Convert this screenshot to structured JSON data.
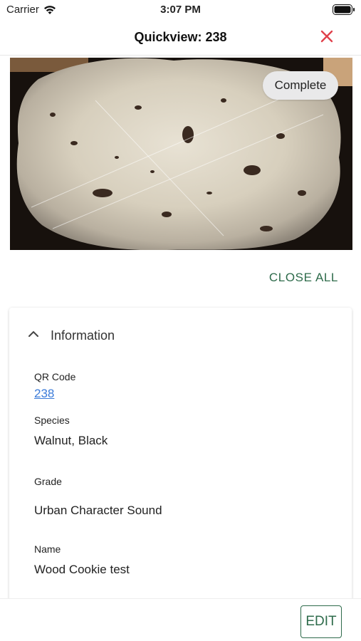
{
  "status_bar": {
    "carrier": "Carrier",
    "time": "3:07 PM"
  },
  "nav": {
    "title": "Quickview: 238",
    "close_icon": "close-x-icon",
    "close_color": "#e0414b"
  },
  "photo": {
    "status_badge": "Complete"
  },
  "actions": {
    "close_all_label": "CLOSE ALL",
    "edit_label": "EDIT",
    "accent_color": "#2e6b4b"
  },
  "information": {
    "title": "Information",
    "expanded": true,
    "fields": {
      "qr_code": {
        "label": "QR Code",
        "value": "238"
      },
      "species": {
        "label": "Species",
        "value": "Walnut, Black"
      },
      "grade": {
        "label": "Grade",
        "value": "Urban Character Sound"
      },
      "name": {
        "label": "Name",
        "value": "Wood Cookie test"
      }
    }
  }
}
